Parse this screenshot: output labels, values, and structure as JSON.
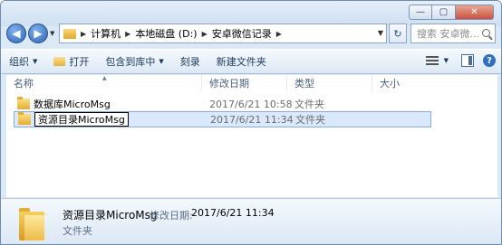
{
  "search": {
    "placeholder": "搜索 安卓微..."
  },
  "address": {
    "crumbs": [
      "计算机",
      "本地磁盘 (D:)",
      "安卓微信记录"
    ]
  },
  "toolbar": {
    "organize": "组织",
    "open": "打开",
    "include_library": "包含到库中",
    "burn": "刻录",
    "new_folder": "新建文件夹"
  },
  "columns": {
    "name": "名称",
    "date": "修改日期",
    "type": "类型",
    "size": "大小"
  },
  "files": [
    {
      "name": "数据库MicroMsg",
      "date": "2017/6/21 10:58",
      "type": "文件夹"
    },
    {
      "name": "资源目录MicroMsg",
      "date": "2017/6/21 11:34",
      "type": "文件夹"
    }
  ],
  "details": {
    "name": "资源目录MicroMsg",
    "date_label": "修改日期:",
    "date": "2017/6/21 11:34",
    "type": "文件夹"
  }
}
